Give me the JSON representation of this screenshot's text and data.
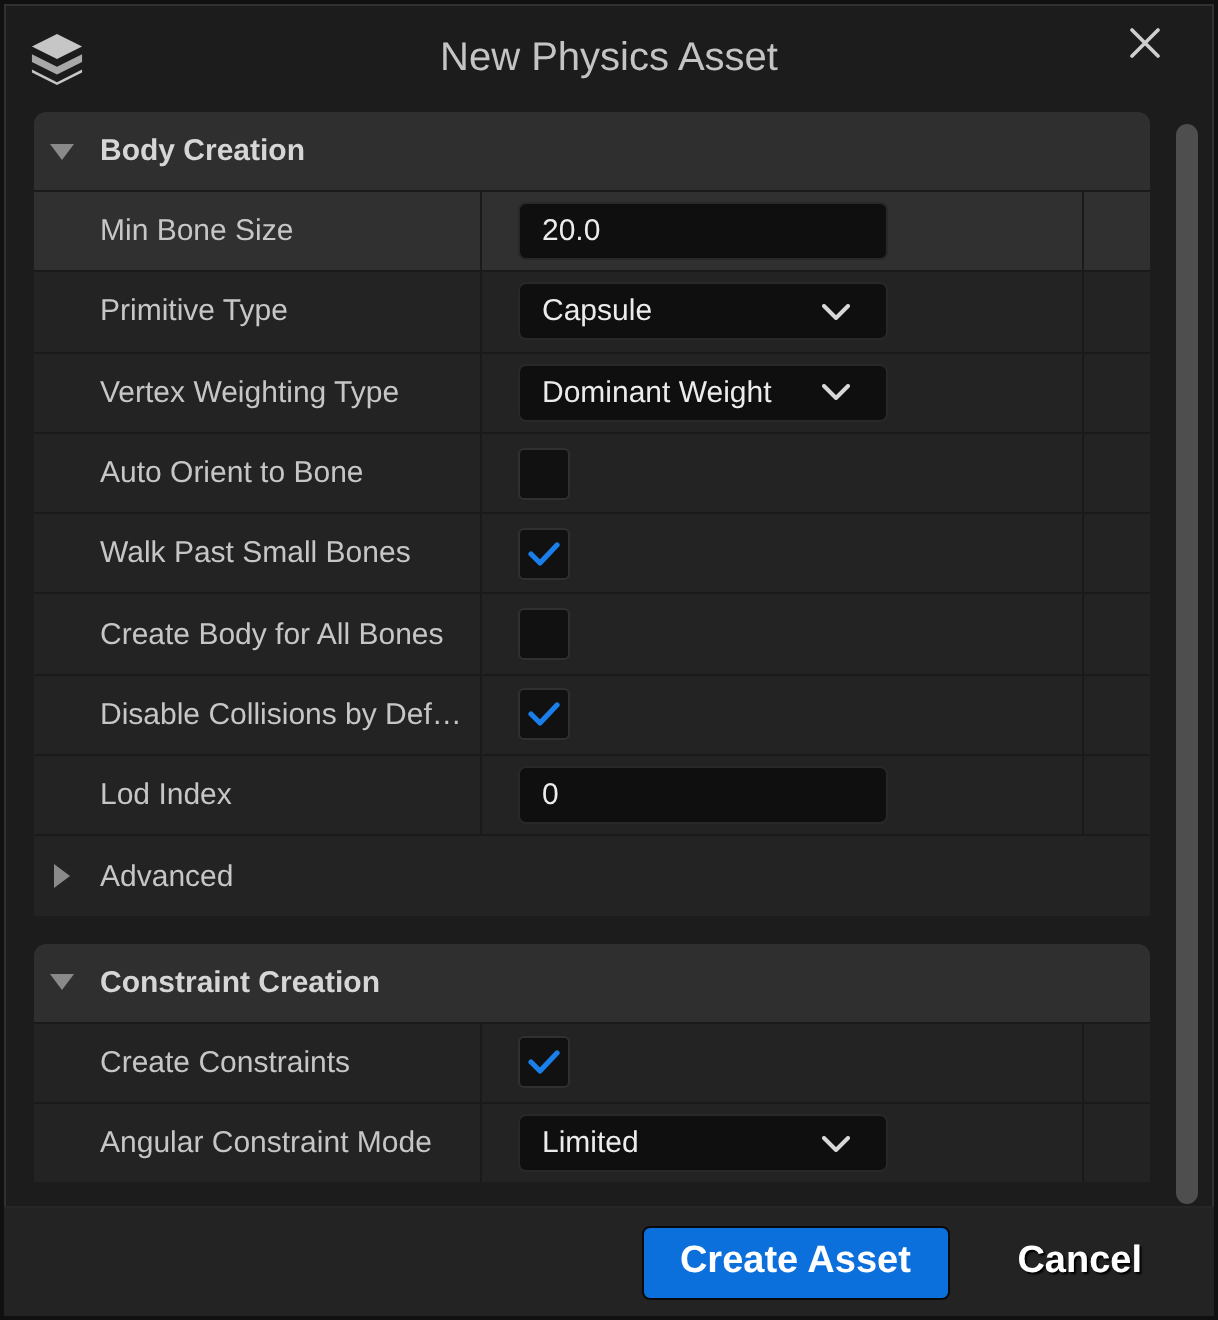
{
  "window": {
    "title": "New Physics Asset"
  },
  "sections": [
    {
      "title": "Body Creation",
      "expanded": true,
      "rows": [
        {
          "kind": "number",
          "label": "Min Bone Size",
          "value": "20.0",
          "highlighted": true
        },
        {
          "kind": "dropdown",
          "label": "Primitive Type",
          "value": "Capsule",
          "highlighted": false
        },
        {
          "kind": "dropdown",
          "label": "Vertex Weighting Type",
          "value": "Dominant Weight",
          "highlighted": false
        },
        {
          "kind": "checkbox",
          "label": "Auto Orient to Bone",
          "checked": false,
          "highlighted": false
        },
        {
          "kind": "checkbox",
          "label": "Walk Past Small Bones",
          "checked": true,
          "highlighted": false
        },
        {
          "kind": "checkbox",
          "label": "Create Body for All Bones",
          "checked": false,
          "highlighted": false
        },
        {
          "kind": "checkbox",
          "label": "Disable Collisions by Def…",
          "checked": true,
          "highlighted": false
        },
        {
          "kind": "number",
          "label": "Lod Index",
          "value": "0",
          "highlighted": false
        },
        {
          "kind": "group",
          "label": "Advanced",
          "expanded": false,
          "highlighted": false
        }
      ]
    },
    {
      "title": "Constraint Creation",
      "expanded": true,
      "rows": [
        {
          "kind": "checkbox",
          "label": "Create Constraints",
          "checked": true,
          "highlighted": false
        },
        {
          "kind": "dropdown",
          "label": "Angular Constraint Mode",
          "value": "Limited",
          "highlighted": false
        }
      ]
    }
  ],
  "buttons": [
    {
      "label": "Create Asset",
      "kind": "primary"
    },
    {
      "label": "Cancel",
      "kind": "secondary"
    }
  ]
}
